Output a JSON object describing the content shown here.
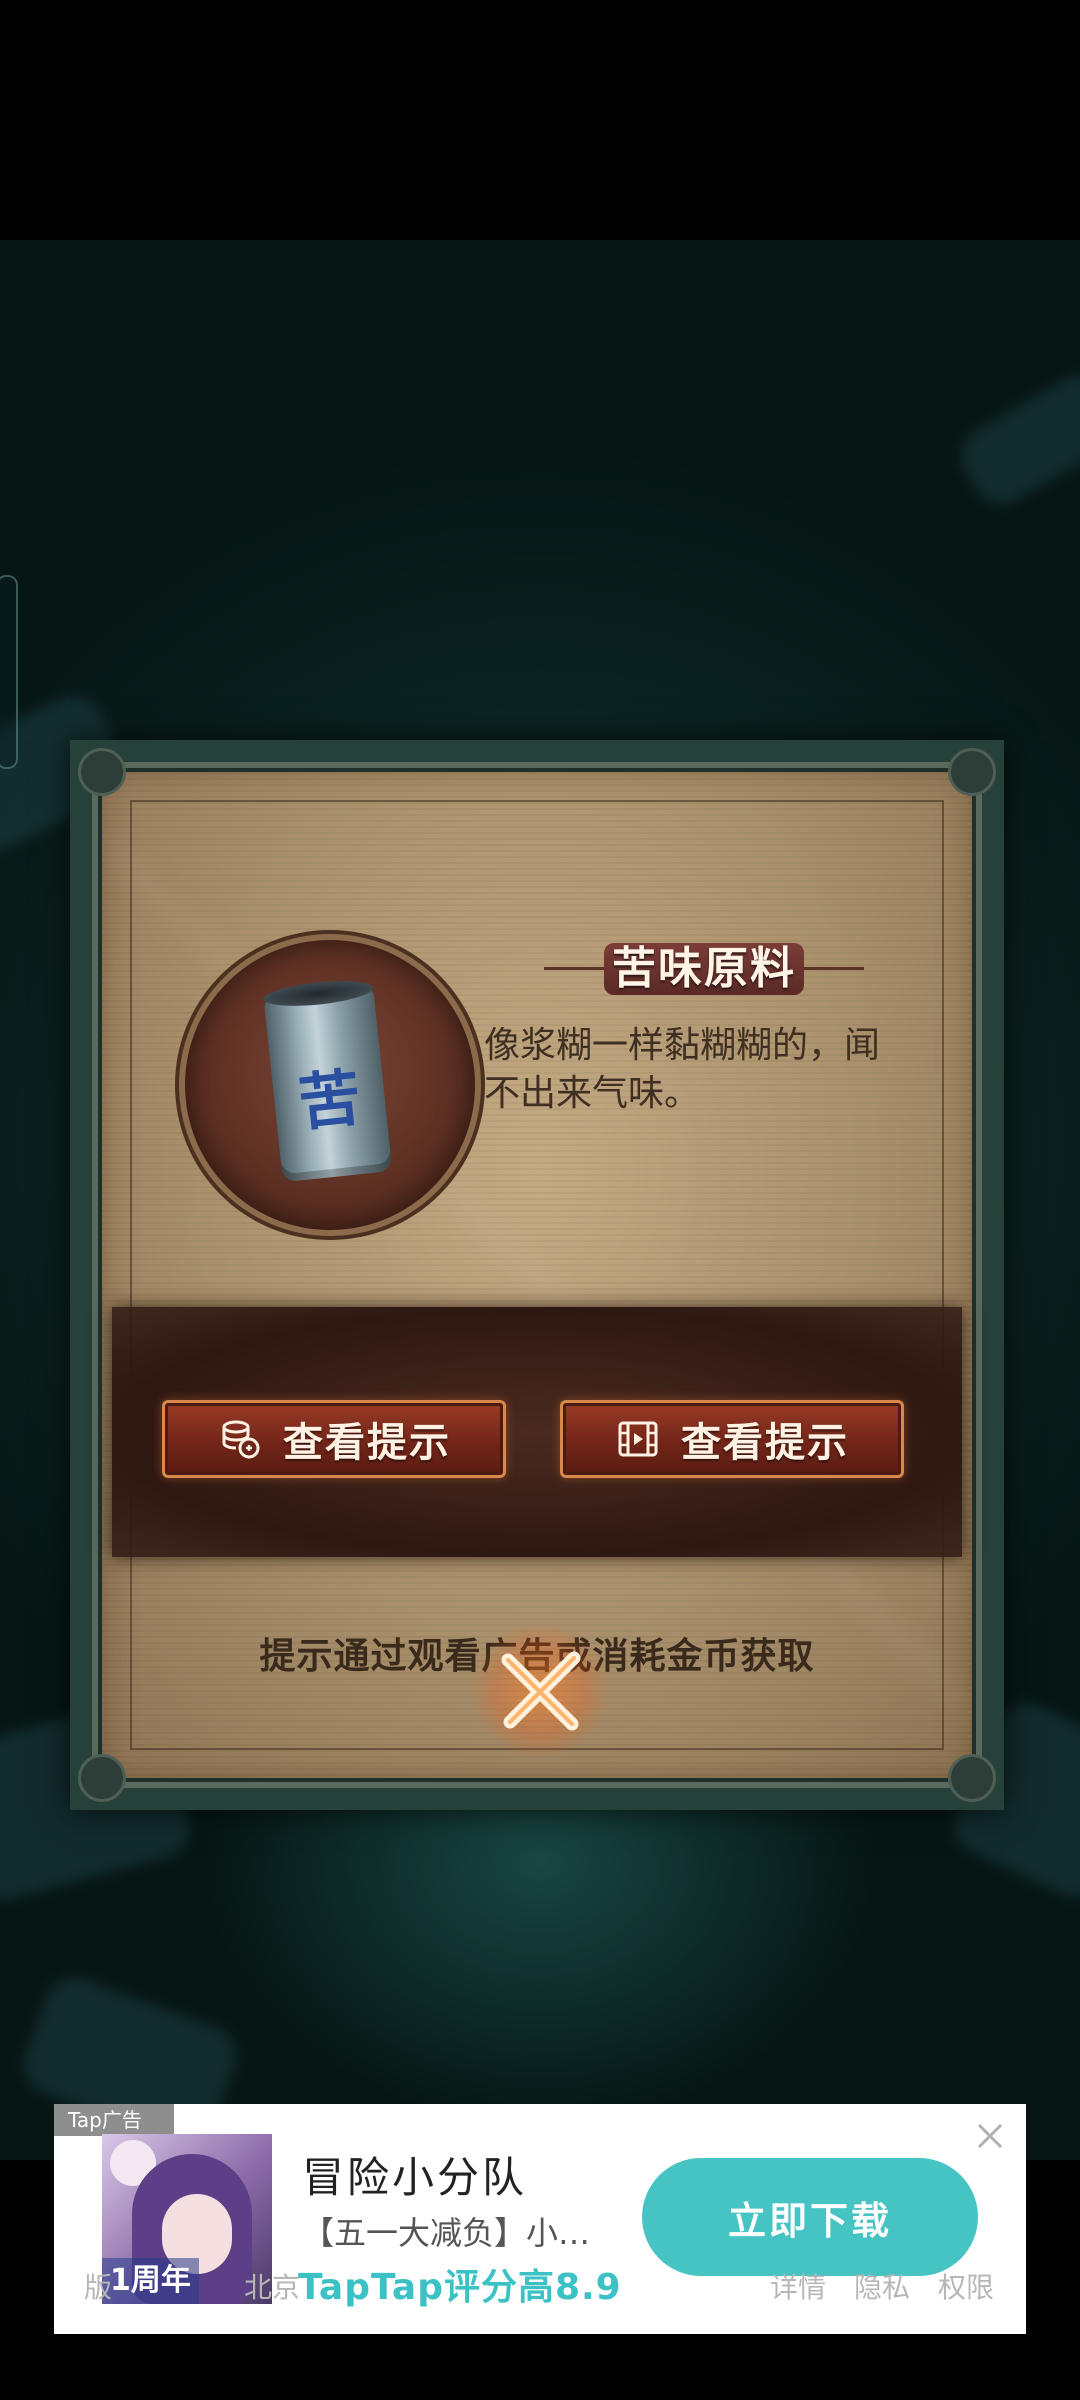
{
  "item": {
    "name": "苦味原料",
    "description": "像浆糊一样黏糊糊的，闻不出来气味。",
    "icon": "bitter-can-icon",
    "can_label": "苦"
  },
  "buttons": [
    {
      "label": "查看提示",
      "icon": "coins-icon"
    },
    {
      "label": "查看提示",
      "icon": "video-ad-icon"
    }
  ],
  "hint_note": "提示通过观看广告或消耗金币获取",
  "close": {
    "icon": "close-x-icon"
  },
  "ad": {
    "tag": "Tap广告",
    "app_name": "冒险小分队",
    "promo": "【五一大减负】小…",
    "rating": "TapTap评分高8.9",
    "cta": "立即下载",
    "anniversary": "1周年",
    "footer_left": [
      "版",
      "北京"
    ],
    "footer_right": [
      "详情",
      "隐私",
      "权限"
    ],
    "close_icon": "close-icon"
  },
  "colors": {
    "accent_button": "#8c2f1f",
    "cta": "#46c3c3",
    "parchment": "#b79d77"
  }
}
